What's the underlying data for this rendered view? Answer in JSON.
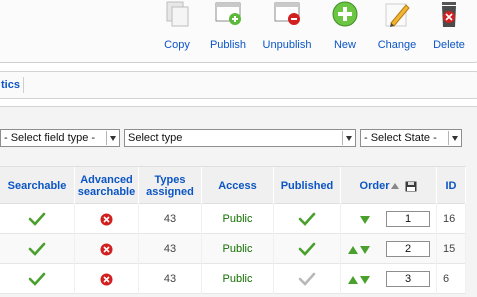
{
  "toolbar": {
    "copy": "Copy",
    "publish": "Publish",
    "unpublish": "Unpublish",
    "new": "New",
    "change": "Change",
    "delete": "Delete"
  },
  "submenu": {
    "tab_label": "tics"
  },
  "filters": {
    "field_type": "- Select field type -",
    "type": "Select type",
    "state": "- Select State -"
  },
  "table": {
    "headers": {
      "searchable": "Searchable",
      "advanced_searchable": "Advanced searchable",
      "types_assigned": "Types assigned",
      "access": "Access",
      "published": "Published",
      "order": "Order",
      "id": "ID"
    },
    "rows": [
      {
        "searchable": "yes",
        "advanced_searchable": "no",
        "types_assigned": "43",
        "access": "Public",
        "published": "yes",
        "order": "1",
        "id": "16"
      },
      {
        "searchable": "yes",
        "advanced_searchable": "no",
        "types_assigned": "43",
        "access": "Public",
        "published": "yes",
        "order": "2",
        "id": "15"
      },
      {
        "searchable": "yes",
        "advanced_searchable": "no",
        "types_assigned": "43",
        "access": "Public",
        "published": "grey",
        "order": "3",
        "id": "6"
      }
    ]
  },
  "colors": {
    "link_blue": "#0b55c4",
    "access_green": "#137000",
    "check_green": "#4aa02c",
    "delete_red": "#d21f1f"
  }
}
